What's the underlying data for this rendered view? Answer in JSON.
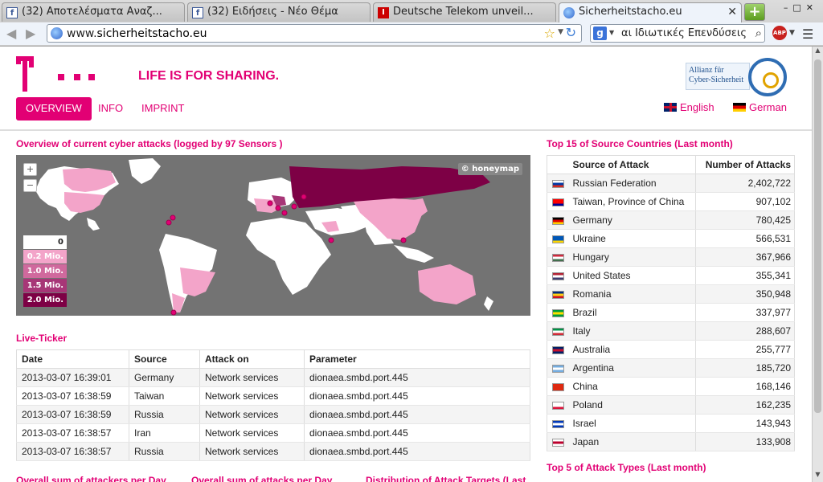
{
  "browser": {
    "tabs": [
      {
        "title": "(32) Αποτελέσματα Αναζ...",
        "icon": "facebook-icon"
      },
      {
        "title": "(32) Ειδήσεις - Νέο Θέμα",
        "icon": "facebook-icon"
      },
      {
        "title": "Deutsche Telekom unveil...",
        "icon": "ted-icon"
      },
      {
        "title": "Sicherheitstacho.eu",
        "icon": "globe-icon"
      }
    ],
    "url_prefix": "www.",
    "url_domain": "sicherheitstacho.eu",
    "search_text": "αι Ιδιωτικές Επενδύσεις",
    "search_engine": "g",
    "adblock_label": "ABP"
  },
  "header": {
    "slogan": "LIFE IS FOR SHARING.",
    "partner_logo_text": "Allianz für Cyber-Sicherheit",
    "nav": [
      "OVERVIEW",
      "INFO",
      "IMPRINT"
    ],
    "languages": [
      "English",
      "German"
    ]
  },
  "map": {
    "title": "Overview of current cyber attacks (logged by 97 Sensors )",
    "zoom_in": "+",
    "zoom_out": "−",
    "attribution": "© honeymap",
    "legend": [
      "0",
      "0.2 Mio.",
      "1.0 Mio.",
      "1.5 Mio.",
      "2.0 Mio."
    ],
    "legend_colors": [
      "#ffffff",
      "#f3a4c9",
      "#d0699d",
      "#a73677",
      "#7d0045"
    ]
  },
  "ticker": {
    "title": "Live-Ticker",
    "headers": [
      "Date",
      "Source",
      "Attack on",
      "Parameter"
    ],
    "rows": [
      [
        "2013-03-07 16:39:01",
        "Germany",
        "Network services",
        "dionaea.smbd.port.445"
      ],
      [
        "2013-03-07 16:38:59",
        "Taiwan",
        "Network services",
        "dionaea.smbd.port.445"
      ],
      [
        "2013-03-07 16:38:59",
        "Russia",
        "Network services",
        "dionaea.smbd.port.445"
      ],
      [
        "2013-03-07 16:38:57",
        "Iran",
        "Network services",
        "dionaea.smbd.port.445"
      ],
      [
        "2013-03-07 16:38:57",
        "Russia",
        "Network services",
        "dionaea.smbd.port.445"
      ]
    ]
  },
  "countries": {
    "title": "Top 15 of Source Countries (Last month)",
    "headers": [
      "Source of Attack",
      "Number of Attacks"
    ],
    "rows": [
      {
        "name": "Russian Federation",
        "value": "2,402,722",
        "flag": [
          "#ffffff",
          "#0039a6",
          "#d52b1e"
        ]
      },
      {
        "name": "Taiwan, Province of China",
        "value": "907,102",
        "flag": [
          "#fe0000",
          "#fe0000",
          "#000095"
        ]
      },
      {
        "name": "Germany",
        "value": "780,425",
        "flag": [
          "#000000",
          "#dd0000",
          "#ffce00"
        ]
      },
      {
        "name": "Ukraine",
        "value": "566,531",
        "flag": [
          "#0057b7",
          "#0057b7",
          "#ffd700"
        ]
      },
      {
        "name": "Hungary",
        "value": "367,966",
        "flag": [
          "#cd2a3e",
          "#ffffff",
          "#436f4d"
        ]
      },
      {
        "name": "United States",
        "value": "355,341",
        "flag": [
          "#b22234",
          "#ffffff",
          "#3c3b6e"
        ]
      },
      {
        "name": "Romania",
        "value": "350,948",
        "flag": [
          "#002b7f",
          "#fcd116",
          "#ce1126"
        ]
      },
      {
        "name": "Brazil",
        "value": "337,977",
        "flag": [
          "#009c3b",
          "#ffdf00",
          "#009c3b"
        ]
      },
      {
        "name": "Italy",
        "value": "288,607",
        "flag": [
          "#009246",
          "#ffffff",
          "#ce2b37"
        ]
      },
      {
        "name": "Australia",
        "value": "255,777",
        "flag": [
          "#012169",
          "#c8102e",
          "#012169"
        ]
      },
      {
        "name": "Argentina",
        "value": "185,720",
        "flag": [
          "#74acdf",
          "#ffffff",
          "#74acdf"
        ]
      },
      {
        "name": "China",
        "value": "168,146",
        "flag": [
          "#de2910",
          "#de2910",
          "#de2910"
        ]
      },
      {
        "name": "Poland",
        "value": "162,235",
        "flag": [
          "#ffffff",
          "#ffffff",
          "#dc143c"
        ]
      },
      {
        "name": "Israel",
        "value": "143,943",
        "flag": [
          "#0038b8",
          "#ffffff",
          "#0038b8"
        ]
      },
      {
        "name": "Japan",
        "value": "133,908",
        "flag": [
          "#ffffff",
          "#bc002d",
          "#ffffff"
        ]
      }
    ]
  },
  "attack_types_title": "Top 5 of Attack Types (Last month)",
  "bottom_titles": [
    "Overall sum of attackers per Day",
    "Overall sum of attacks per Day",
    "Distribution of Attack Targets (Last"
  ],
  "colors": {
    "brand": "#e20074"
  }
}
